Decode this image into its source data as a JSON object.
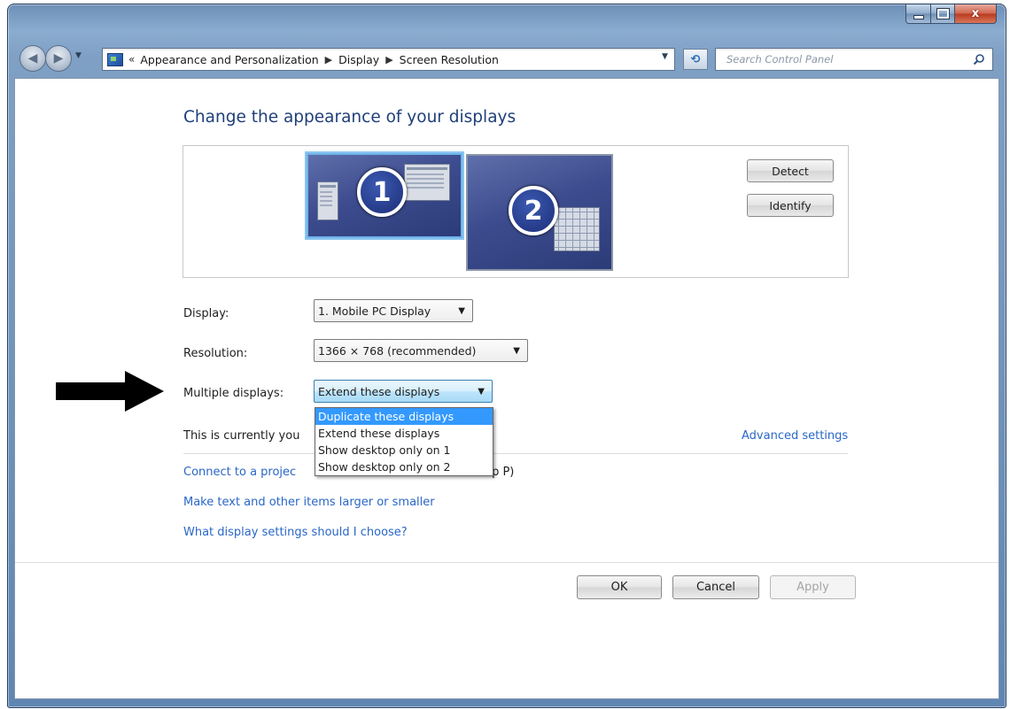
{
  "window": {
    "caption_buttons": [
      "minimize",
      "maximize",
      "close"
    ],
    "close_glyph": "x"
  },
  "navbar": {
    "back_icon": "back-arrow-icon",
    "forward_icon": "forward-arrow-icon",
    "breadcrumb_lead": "«",
    "breadcrumbs": [
      "Appearance and Personalization",
      "Display",
      "Screen Resolution"
    ],
    "refresh_icon": "refresh-icon",
    "search_placeholder": "Search Control Panel"
  },
  "main": {
    "title": "Change the appearance of your displays",
    "monitors": [
      {
        "number": "1",
        "selected": true
      },
      {
        "number": "2",
        "selected": false
      }
    ],
    "detect_label": "Detect",
    "identify_label": "Identify",
    "display_label": "Display:",
    "display_value": "1. Mobile PC Display",
    "resolution_label": "Resolution:",
    "resolution_value": "1366 × 768 (recommended)",
    "multiple_displays_label": "Multiple displays:",
    "multiple_displays_value": "Extend these displays",
    "multiple_displays_options": [
      {
        "label": "Duplicate these displays",
        "highlighted": true
      },
      {
        "label": "Extend these displays",
        "highlighted": false
      },
      {
        "label": "Show desktop only on 1",
        "highlighted": false
      },
      {
        "label": "Show desktop only on 2",
        "highlighted": false
      }
    ],
    "status_text": "This is currently you",
    "advanced_settings_link": "Advanced settings",
    "links": [
      "Connect to a projec",
      "Make text and other items larger or smaller",
      "What display settings should I choose?"
    ],
    "link_tail": "tap P)"
  },
  "footer": {
    "ok_label": "OK",
    "cancel_label": "Cancel",
    "apply_label": "Apply",
    "apply_enabled": false
  },
  "annotation": {
    "arrow_icon": "pointer-arrow-icon",
    "color": "#000000"
  },
  "colors": {
    "title_blue": "#1f3f7a",
    "link_blue": "#2a66c7",
    "selection_blue": "#3399ff",
    "window_frame": "#7fa0c4"
  }
}
